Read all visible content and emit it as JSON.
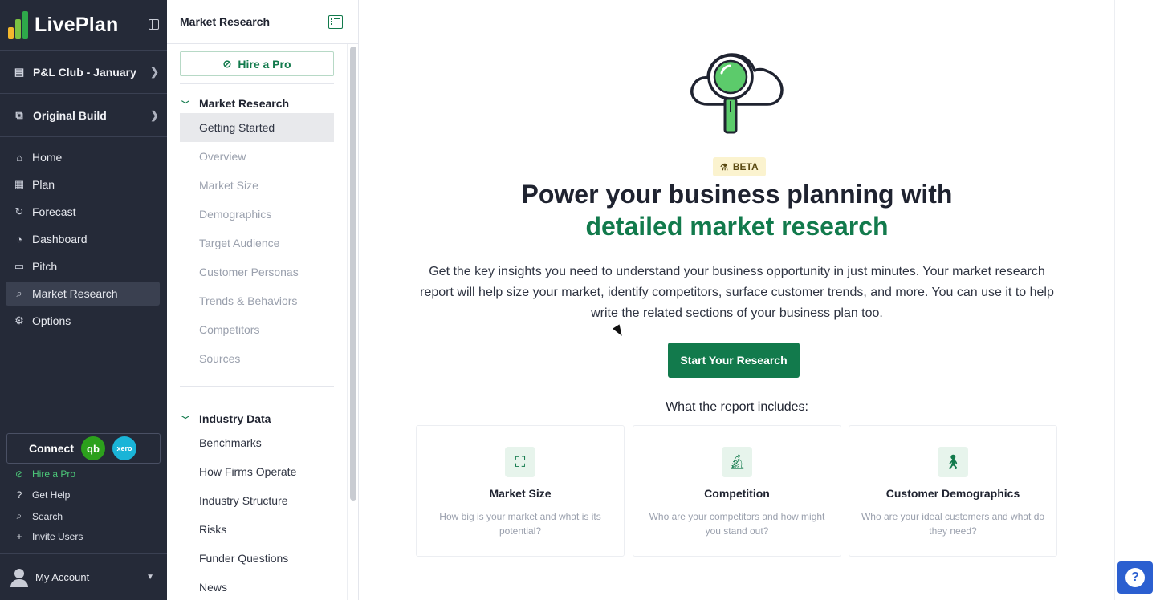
{
  "brand": {
    "name": "LivePlan",
    "colors": {
      "nav_bg": "#252a38",
      "accent_green": "#127a4c",
      "beta_bg": "#fbf3cf",
      "help_blue": "#2b5fd0"
    }
  },
  "leftnav": {
    "company": "P&L Club - January",
    "build": "Original Build",
    "items": [
      {
        "label": "Home",
        "icon": "home-icon"
      },
      {
        "label": "Plan",
        "icon": "plan-icon"
      },
      {
        "label": "Forecast",
        "icon": "forecast-icon"
      },
      {
        "label": "Dashboard",
        "icon": "dashboard-icon"
      },
      {
        "label": "Pitch",
        "icon": "pitch-icon"
      },
      {
        "label": "Market Research",
        "icon": "market-research-icon",
        "active": true
      },
      {
        "label": "Options",
        "icon": "options-icon"
      }
    ],
    "connect": {
      "label": "Connect",
      "qb": "qb",
      "xero": "xero"
    },
    "utilities": [
      {
        "label": "Hire a Pro",
        "icon": "hire-pro-icon"
      },
      {
        "label": "Get Help",
        "icon": "help-icon"
      },
      {
        "label": "Search",
        "icon": "search-icon"
      },
      {
        "label": "Invite Users",
        "icon": "invite-users-icon"
      }
    ],
    "account": "My Account"
  },
  "sidepanel": {
    "title": "Market Research",
    "hire_button": "Hire a Pro",
    "section1": {
      "title": "Market Research",
      "items": [
        "Getting Started",
        "Overview",
        "Market Size",
        "Demographics",
        "Target Audience",
        "Customer Personas",
        "Trends & Behaviors",
        "Competitors",
        "Sources"
      ]
    },
    "section2": {
      "title": "Industry Data",
      "items": [
        "Benchmarks",
        "How Firms Operate",
        "Industry Structure",
        "Risks",
        "Funder Questions",
        "News"
      ]
    }
  },
  "main": {
    "beta": "BETA",
    "headline_line1": "Power your business planning with",
    "headline_line2": "detailed market research",
    "intro": "Get the key insights you need to understand your business opportunity in just minutes. Your market research report will help size your market, identify competitors, surface customer trends, and more. You can use it to help write the related sections of your business plan too.",
    "start_button": "Start Your Research",
    "includes_label": "What the report includes:",
    "cards": [
      {
        "title": "Market Size",
        "desc": "How big is your market and what is its potential?",
        "icon": "expand-icon"
      },
      {
        "title": "Competition",
        "desc": "Who are your competitors and how might you stand out?",
        "icon": "microscope-icon"
      },
      {
        "title": "Customer Demographics",
        "desc": "Who are your ideal customers and what do they need?",
        "icon": "person-icon"
      }
    ]
  },
  "help": {
    "label": "?"
  }
}
